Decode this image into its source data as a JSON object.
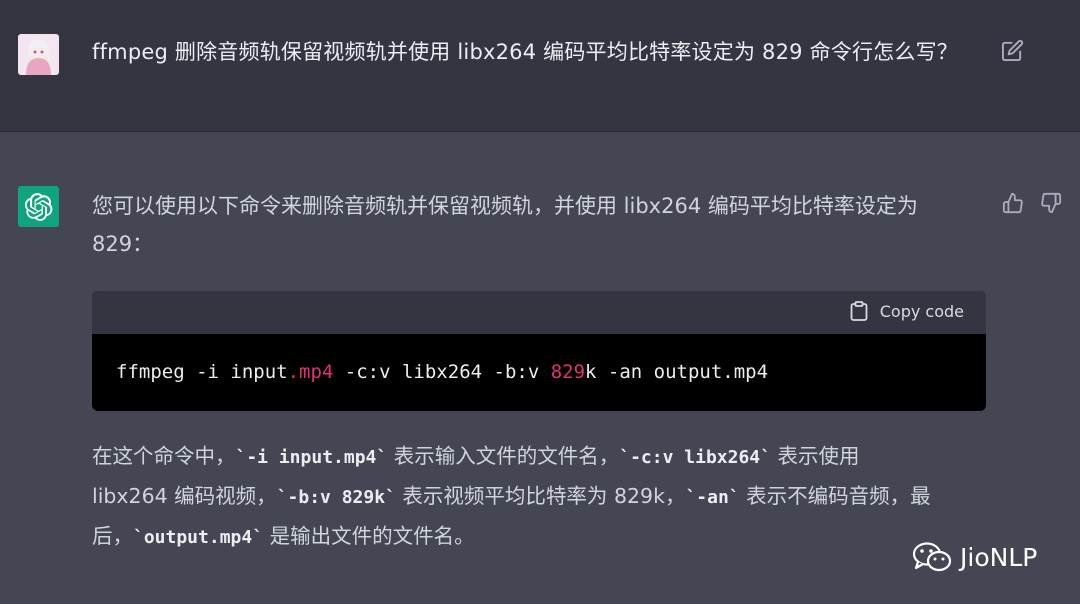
{
  "user_message": {
    "text": "ffmpeg 删除音频轨保留视频轨并使用 libx264 编码平均比特率设定为 829 命令行怎么写？"
  },
  "assistant_message": {
    "intro_line1": "您可以使用以下命令来删除音频轨并保留视频轨，并使用 libx264 编码平均比特率设定为",
    "intro_line2": "829：",
    "code": {
      "copy_label": "Copy code",
      "part1": "ffmpeg -i input",
      "part2": ".mp4",
      "part3": " -c:v libx264 -b:v ",
      "part4": "829",
      "part5": "k -an output.mp4"
    },
    "explain": {
      "t1": "在这个命令中，",
      "c1": "`-i input.mp4`",
      "t2": " 表示输入文件的文件名，",
      "c2": "`-c:v libx264`",
      "t3": " 表示使用",
      "t4": "libx264 编码视频，",
      "c3": "`-b:v 829k`",
      "t5": " 表示视频平均比特率为 829k，",
      "c4": "`-an`",
      "t6": " 表示不编码音频，最",
      "t7": "后，",
      "c5": "`output.mp4`",
      "t8": " 是输出文件的文件名。"
    }
  },
  "watermark": {
    "text": "JioNLP"
  },
  "icons": {
    "edit": "edit-icon",
    "thumbs_up": "thumbs-up-icon",
    "thumbs_down": "thumbs-down-icon",
    "copy": "clipboard-icon",
    "wechat": "wechat-icon"
  },
  "colors": {
    "accent": "#10a37f",
    "code_highlight": "#df3079"
  }
}
